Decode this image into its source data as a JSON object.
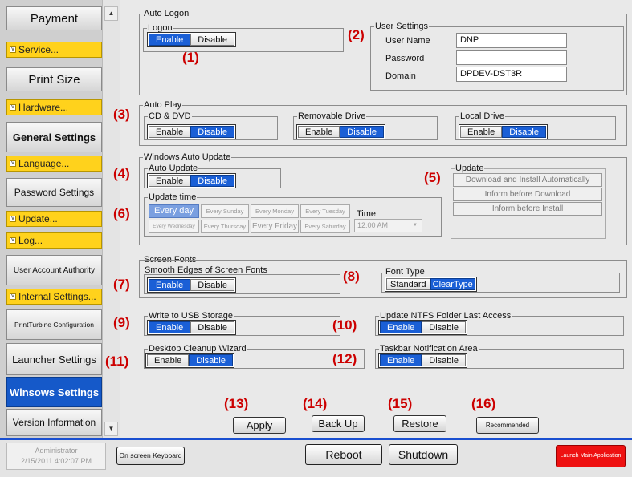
{
  "sidebar": {
    "items": [
      {
        "label": "Payment",
        "kind": "btn"
      },
      {
        "label": "Service...",
        "kind": "yellow"
      },
      {
        "label": "Print Size",
        "kind": "btn"
      },
      {
        "label": "Hardware...",
        "kind": "yellow"
      },
      {
        "label": "General Settings",
        "kind": "btn"
      },
      {
        "label": "Language...",
        "kind": "yellow"
      },
      {
        "label": "Password Settings",
        "kind": "btn"
      },
      {
        "label": "Update...",
        "kind": "yellow"
      },
      {
        "label": "Log...",
        "kind": "yellow"
      },
      {
        "label": "User Account Authority",
        "kind": "btn"
      },
      {
        "label": "Internal Settings...",
        "kind": "yellow"
      },
      {
        "label": "PrintTurbine Configuration",
        "kind": "btn"
      },
      {
        "label": "Launcher Settings",
        "kind": "btn"
      },
      {
        "label": "Winsows Settings",
        "kind": "active"
      },
      {
        "label": "Version Information",
        "kind": "btn"
      }
    ],
    "scroll_up": "▲",
    "scroll_down": "▼"
  },
  "auto_logon": {
    "title": "Auto Logon",
    "logon_title": "Logon",
    "enable": "Enable",
    "disable": "Disable",
    "selected": "Enable",
    "user_settings": {
      "title": "User Settings",
      "user_name_label": "User Name",
      "user_name": "DNP",
      "password_label": "Password",
      "password": "",
      "domain_label": "Domain",
      "domain": "DPDEV-DST3R"
    }
  },
  "auto_play": {
    "title": "Auto Play",
    "cd_dvd": "CD & DVD",
    "removable": "Removable Drive",
    "local": "Local Drive",
    "enable": "Enable",
    "disable": "Disable",
    "selected": "Disable"
  },
  "windows_update": {
    "title": "Windows Auto Update",
    "auto_update_label": "Auto Update",
    "enable": "Enable",
    "disable": "Disable",
    "selected": "Disable",
    "update_time_label": "Update time",
    "days": [
      "Every day",
      "Every Sunday",
      "Every Monday",
      "Every Tuesday",
      "Every Wednesday",
      "Every Thursday",
      "Every Friday",
      "Every Saturday"
    ],
    "selected_day": "Every day",
    "time_label": "Time",
    "time_value": "12:00 AM",
    "time_arrow": "▼",
    "update_group_title": "Update",
    "update_options": [
      "Download and Install Automatically",
      "Inform before Download",
      "Inform before Install"
    ]
  },
  "screen_fonts": {
    "title": "Screen Fonts",
    "smooth_label": "Smooth Edges of Screen Fonts",
    "enable": "Enable",
    "disable": "Disable",
    "selected": "Enable",
    "font_type_label": "Font Type",
    "standard": "Standard",
    "cleartype": "ClearType",
    "font_selected": "ClearType"
  },
  "usb": {
    "title": "Write to USB Storage",
    "enable": "Enable",
    "disable": "Disable",
    "selected": "Enable"
  },
  "ntfs": {
    "title": "Update NTFS Folder Last Access",
    "enable": "Enable",
    "disable": "Disable",
    "selected": "Enable"
  },
  "cleanup": {
    "title": "Desktop Cleanup Wizard",
    "enable": "Enable",
    "disable": "Disable",
    "selected": "Disable"
  },
  "taskbar": {
    "title": "Taskbar Notification Area",
    "enable": "Enable",
    "disable": "Disable",
    "selected": "Enable"
  },
  "actions": {
    "apply": "Apply",
    "backup": "Back Up",
    "restore": "Restore",
    "recommended": "Recommended"
  },
  "callouts": [
    "(1)",
    "(2)",
    "(3)",
    "(4)",
    "(5)",
    "(6)",
    "(7)",
    "(8)",
    "(9)",
    "(10)",
    "(11)",
    "(12)",
    "(13)",
    "(14)",
    "(15)",
    "(16)"
  ],
  "bottom": {
    "user": "Administrator",
    "datetime": "2/15/2011 4:02:07 PM",
    "keyboard": "On screen Keyboard",
    "reboot": "Reboot",
    "shutdown": "Shutdown",
    "launch": "Launch Main Application"
  },
  "colors": {
    "accent": "#1a5fd6",
    "sidebar_highlight": "#ffd21c",
    "active": "#1559c9",
    "callout": "#cc0000",
    "launch": "#ee1111"
  }
}
